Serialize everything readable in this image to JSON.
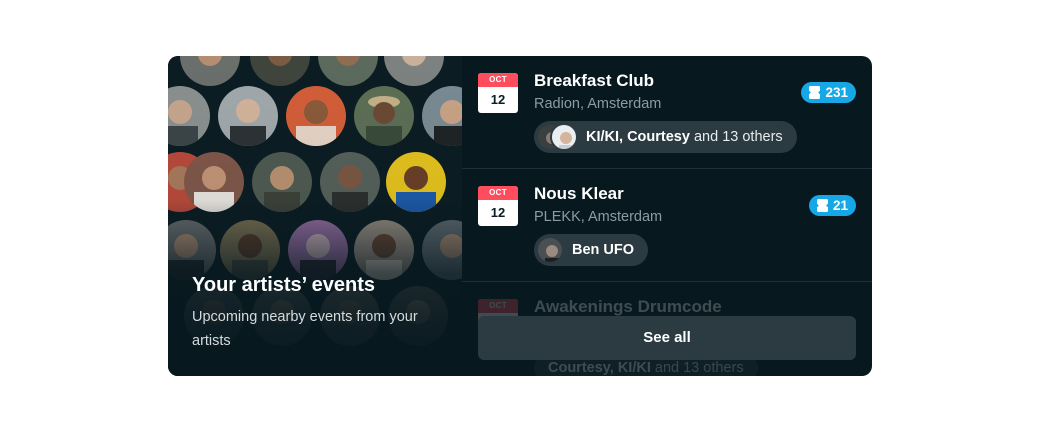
{
  "panel": {
    "title": "Your artists’ events",
    "subtitle": "Upcoming nearby events from your artists"
  },
  "events": [
    {
      "month": "OCT",
      "day": "12",
      "title": "Breakfast Club",
      "venue": "Radion, Amsterdam",
      "ticket_count": "231",
      "artists_bold": "KI/KI, Courtesy",
      "artists_rest": "and 13 others"
    },
    {
      "month": "OCT",
      "day": "12",
      "title": "Nous Klear",
      "venue": "PLEKK, Amsterdam",
      "ticket_count": "21",
      "artists_bold": "Ben UFO",
      "artists_rest": ""
    },
    {
      "month": "OCT",
      "day": "",
      "title": "Awakenings Drumcode",
      "venue": "",
      "ticket_count": "",
      "artists_bold": "Courtesy, KI/KI",
      "artists_rest": "and 13 others"
    }
  ],
  "see_all": {
    "label": "See all"
  },
  "icons": {
    "ticket": "ticket-icon",
    "calendar": "calendar-icon"
  },
  "colors": {
    "accent": "#16a8e6",
    "calendar_red": "#ff4d5e",
    "card_bg": "#07181f"
  }
}
